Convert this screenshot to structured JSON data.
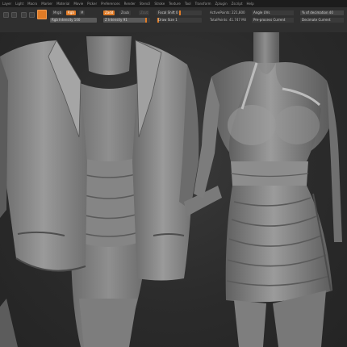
{
  "menu": {
    "items": [
      "Layer",
      "Light",
      "Macro",
      "Marker",
      "Material",
      "Movie",
      "Picker",
      "Preferences",
      "Render",
      "Stencil",
      "Stroke",
      "Texture",
      "Tool",
      "Transform",
      "Zplugin",
      "Zscript",
      "Help"
    ]
  },
  "toolbar": {
    "mrgb_label": "Mrgb",
    "rgb_label": "Rgb",
    "m_label": "M",
    "rgb_intensity": "Rgb Intensity 100",
    "zadd_label": "Zadd",
    "zsub_label": "Zsub",
    "zcut_label": "Zcut",
    "z_intensity": "Z Intensity 91",
    "focal_shift": "Focal Shift 0",
    "draw_size": "Draw Size 1",
    "active_points": "ActivePoints: 221,800",
    "total_points": "TotalPoints: 41.747 Mil",
    "angle_label": "Angle UVs",
    "preview_label": "Pre-process Current",
    "polish_label": "% of decimation 40",
    "decimate_label": "Decimate Current"
  },
  "colors": {
    "accent": "#e07b26",
    "menubar_bg": "#1c1c1c",
    "shelf_bg": "#2f2f2f",
    "viewport_bg": "#2b2b2b",
    "sculpt_gray": "#8a8a8a"
  },
  "viewport": {
    "content": "3D sculpt of two clothed female torsos: blazer over fitted dress (left) and ruched halter mini dress (right)"
  }
}
